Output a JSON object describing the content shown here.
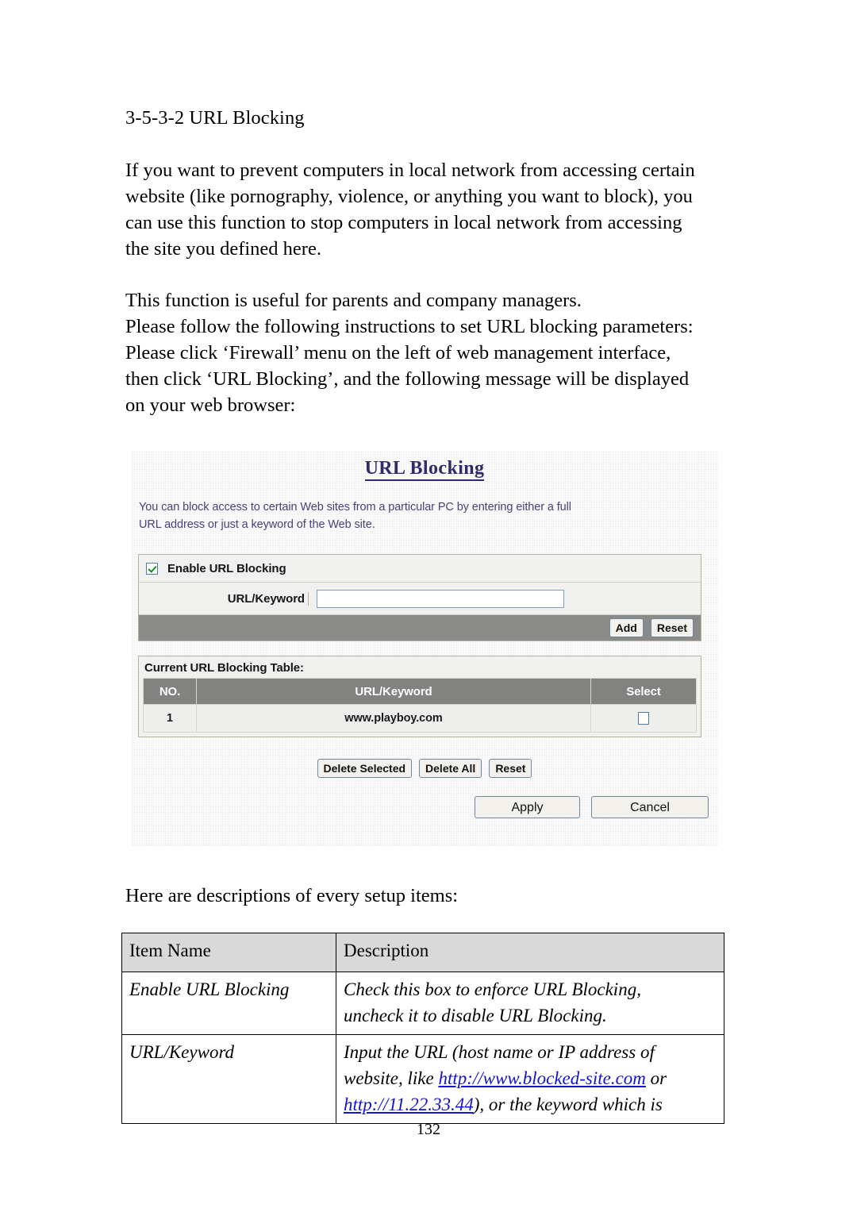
{
  "document": {
    "section_heading": "3-5-3-2 URL Blocking",
    "paragraph_1": [
      "If you want to prevent computers in local network from accessing certain",
      "website (like pornography, violence, or anything you want to block), you",
      "can use this function to stop computers in local network from accessing",
      "the site you defined here."
    ],
    "paragraph_2": [
      "This function is useful for parents and company managers.",
      "Please follow the following instructions to set URL blocking parameters:",
      "Please click ‘Firewall’ menu on the left of web management interface,",
      "then click ‘URL Blocking’, and the following message will be displayed",
      "on your web browser:"
    ],
    "paragraph_3": [
      "Here are descriptions of every setup items:"
    ],
    "page_number": "132"
  },
  "screenshot": {
    "title": "URL Blocking",
    "description": [
      "You can block access to certain Web sites from a particular PC by entering either a full",
      "URL address or just a keyword of the Web site."
    ],
    "enable": {
      "label": "Enable URL Blocking",
      "checked": true
    },
    "field": {
      "label": "URL/Keyword",
      "value": "",
      "placeholder": ""
    },
    "form_buttons": {
      "add": "Add",
      "reset": "Reset"
    },
    "table": {
      "caption": "Current URL Blocking Table:",
      "columns": [
        "NO.",
        "URL/Keyword",
        "Select"
      ],
      "rows": [
        {
          "no": "1",
          "url": "www.playboy.com",
          "selected": false
        }
      ]
    },
    "table_buttons": {
      "delete_selected": "Delete Selected",
      "delete_all": "Delete All",
      "reset": "Reset"
    },
    "bottom_buttons": {
      "apply": "Apply",
      "cancel": "Cancel"
    },
    "colors": {
      "title": "#2e2a6b",
      "description_text": "#4a3f7a",
      "action_bar": "#8a8a88",
      "table_header": "#828280",
      "checkbox_border": "#5279a6",
      "check_mark": "#1a8a26"
    }
  },
  "desc_table": {
    "headers": [
      "Item Name",
      "Description"
    ],
    "rows": [
      {
        "name": "Enable URL Blocking",
        "lines": [
          {
            "parts": [
              {
                "text": "Check this box to enforce URL Blocking,"
              }
            ]
          },
          {
            "parts": [
              {
                "text": "uncheck it to disable URL Blocking."
              }
            ]
          }
        ]
      },
      {
        "name": "URL/Keyword",
        "lines": [
          {
            "parts": [
              {
                "text": "Input the URL (host name or IP address of"
              }
            ]
          },
          {
            "parts": [
              {
                "text": "website, like "
              },
              {
                "text": "http://www.blocked-site.com",
                "link": true
              },
              {
                "text": " or"
              }
            ]
          },
          {
            "parts": [
              {
                "text": "http://11.22.33.44",
                "link": true
              },
              {
                "text": "), or the keyword which is"
              }
            ]
          }
        ]
      }
    ]
  }
}
